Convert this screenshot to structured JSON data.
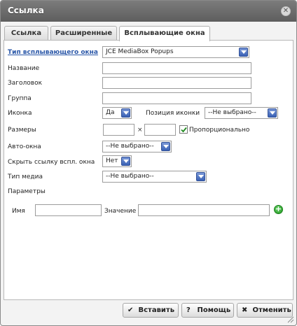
{
  "dialog": {
    "title": "Ссылка",
    "close_icon": "close-icon"
  },
  "tabs": [
    {
      "label": "Ссылка",
      "active": false
    },
    {
      "label": "Расширенные",
      "active": false
    },
    {
      "label": "Всплывающие окна",
      "active": true
    }
  ],
  "form": {
    "popup_type": {
      "label": "Тип всплывающего окна",
      "value": "JCE MediaBox Popups"
    },
    "name": {
      "label": "Название",
      "value": ""
    },
    "title": {
      "label": "Заголовок",
      "value": ""
    },
    "group": {
      "label": "Группа",
      "value": ""
    },
    "icon": {
      "label": "Иконка",
      "value": "Да"
    },
    "icon_position": {
      "label": "Позиция иконки",
      "value": "--Не выбрано--"
    },
    "size": {
      "label": "Размеры",
      "width": "",
      "height": "",
      "times": "×"
    },
    "proportional": {
      "label": "Пропорционально",
      "checked": true
    },
    "auto_popup": {
      "label": "Авто-окна",
      "value": "--Не выбрано--"
    },
    "hide_popup_link": {
      "label": "Скрыть ссылку вспл. окна",
      "value": "Нет"
    },
    "media_type": {
      "label": "Тип медиа",
      "value": "--Не выбрано--"
    },
    "params": {
      "label": "Параметры",
      "name_label": "Имя",
      "value_label": "Значение",
      "name_value": "",
      "value_value": ""
    }
  },
  "buttons": {
    "insert": "Вставить",
    "help": "Помощь",
    "cancel": "Отменить"
  },
  "colors": {
    "titlebar": "#6b6b6b",
    "link_label": "#2a57a8",
    "select_arrow": "#3a62b5",
    "add_button": "#1f9a1f"
  }
}
